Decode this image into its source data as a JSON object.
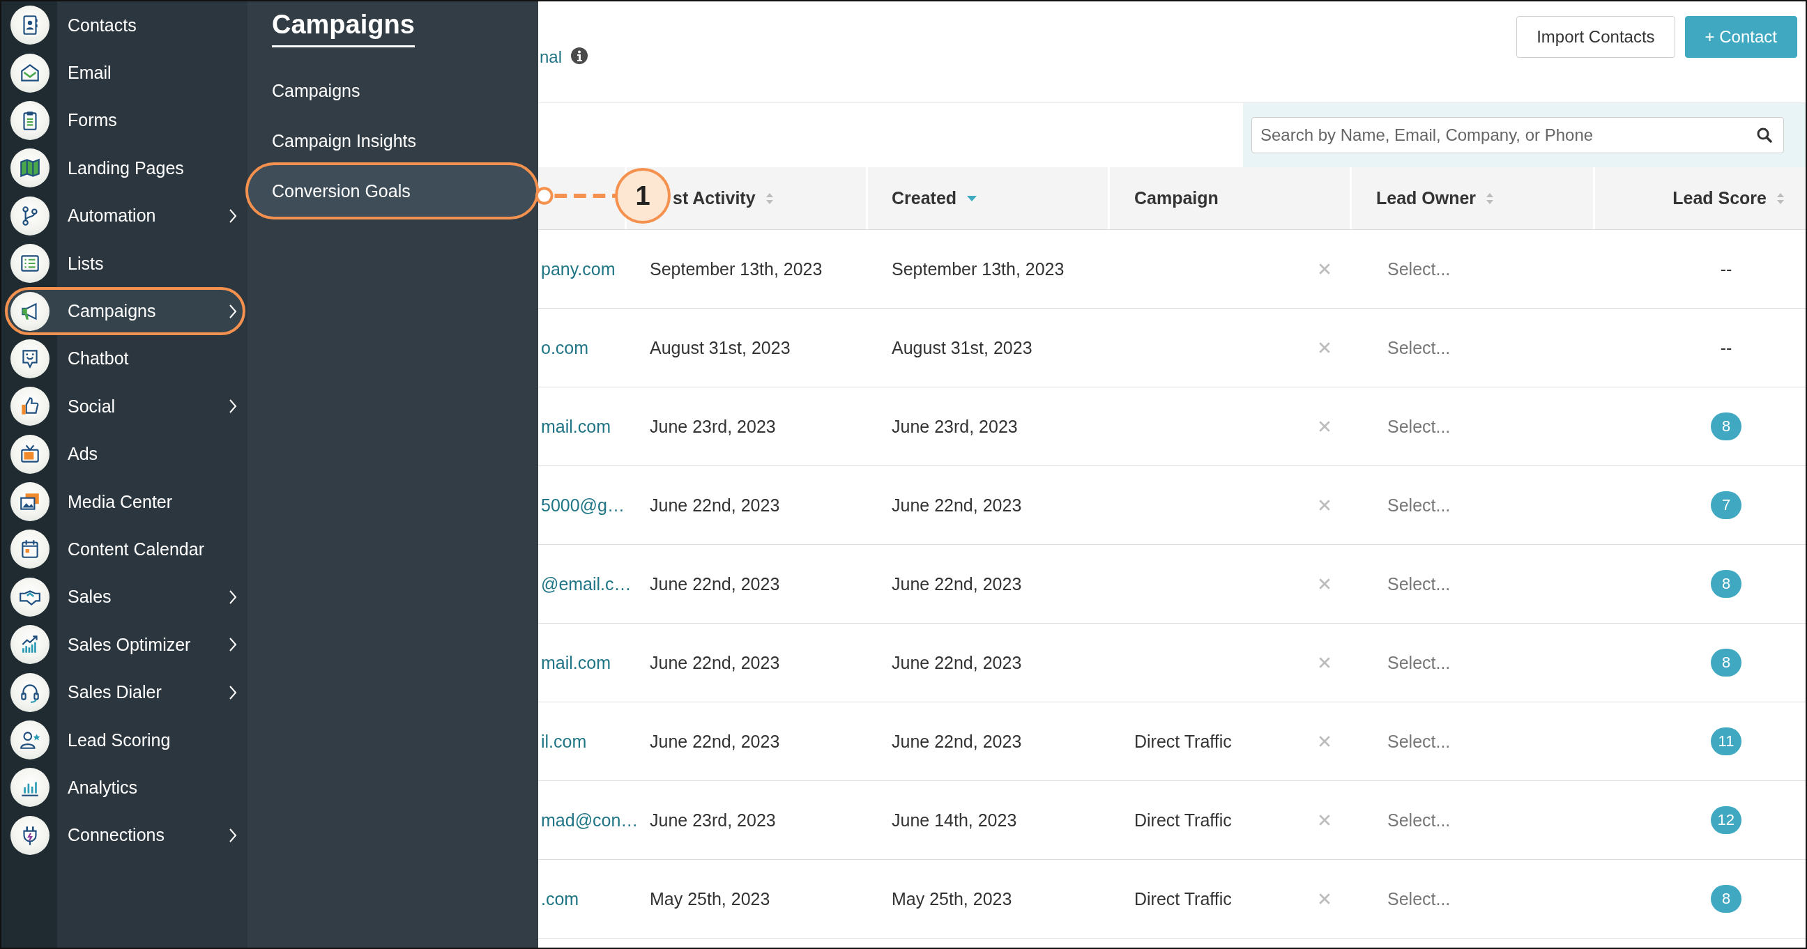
{
  "sidebar": {
    "items": [
      {
        "label": "Contacts",
        "has_submenu": false,
        "selected": false
      },
      {
        "label": "Email",
        "has_submenu": false,
        "selected": false
      },
      {
        "label": "Forms",
        "has_submenu": false,
        "selected": false
      },
      {
        "label": "Landing Pages",
        "has_submenu": false,
        "selected": false
      },
      {
        "label": "Automation",
        "has_submenu": true,
        "selected": false
      },
      {
        "label": "Lists",
        "has_submenu": false,
        "selected": false
      },
      {
        "label": "Campaigns",
        "has_submenu": true,
        "selected": true
      },
      {
        "label": "Chatbot",
        "has_submenu": false,
        "selected": false
      },
      {
        "label": "Social",
        "has_submenu": true,
        "selected": false
      },
      {
        "label": "Ads",
        "has_submenu": false,
        "selected": false
      },
      {
        "label": "Media Center",
        "has_submenu": false,
        "selected": false
      },
      {
        "label": "Content Calendar",
        "has_submenu": false,
        "selected": false
      },
      {
        "label": "Sales",
        "has_submenu": true,
        "selected": false
      },
      {
        "label": "Sales Optimizer",
        "has_submenu": true,
        "selected": false
      },
      {
        "label": "Sales Dialer",
        "has_submenu": true,
        "selected": false
      },
      {
        "label": "Lead Scoring",
        "has_submenu": false,
        "selected": false
      },
      {
        "label": "Analytics",
        "has_submenu": false,
        "selected": false
      },
      {
        "label": "Connections",
        "has_submenu": true,
        "selected": false
      }
    ]
  },
  "submenu": {
    "title": "Campaigns",
    "items": [
      {
        "label": "Campaigns",
        "selected": false
      },
      {
        "label": "Campaign Insights",
        "selected": false
      },
      {
        "label": "Conversion Goals",
        "selected": true
      }
    ]
  },
  "callout": {
    "marker": "1"
  },
  "page": {
    "switch_link": "nal",
    "buttons": [
      {
        "label": "Import Contacts",
        "kind": "secondary"
      },
      {
        "label": "+ Contact",
        "kind": "primary"
      }
    ],
    "search": {
      "placeholder": "Search by Name, Email, Company, or Phone"
    }
  },
  "table": {
    "columns": [
      {
        "label": "st Activity",
        "sortable": true,
        "sorted_descending": false
      },
      {
        "label": "Created",
        "sorted_descending": true
      },
      {
        "label": "Campaign",
        "sortable": false,
        "sorted_descending": false
      },
      {
        "label": "Lead Owner",
        "sortable": true,
        "sorted_descending": false
      },
      {
        "label": "Lead Score",
        "sortable": true,
        "sorted_descending": false
      }
    ],
    "rows": [
      {
        "email": "pany.com",
        "last_activity": "September 13th, 2023",
        "created": "September 13th, 2023",
        "lead_owner": {
          "placeholder": "Select..."
        },
        "lead_score": {
          "kind": "plain",
          "text": "--"
        }
      },
      {
        "email": "o.com",
        "last_activity": "August 31st, 2023",
        "created": "August 31st, 2023",
        "lead_owner": {
          "placeholder": "Select..."
        },
        "lead_score": {
          "kind": "plain",
          "text": "--"
        }
      },
      {
        "email": "mail.com",
        "last_activity": "June 23rd, 2023",
        "created": "June 23rd, 2023",
        "lead_owner": {
          "placeholder": "Select..."
        },
        "lead_score": {
          "kind": "badge",
          "text": "8"
        }
      },
      {
        "email": "5000@g…",
        "last_activity": "June 22nd, 2023",
        "created": "June 22nd, 2023",
        "lead_owner": {
          "placeholder": "Select..."
        },
        "lead_score": {
          "kind": "badge",
          "text": "7"
        }
      },
      {
        "email": "@email.c…",
        "last_activity": "June 22nd, 2023",
        "created": "June 22nd, 2023",
        "lead_owner": {
          "placeholder": "Select..."
        },
        "lead_score": {
          "kind": "badge",
          "text": "8"
        }
      },
      {
        "email": "mail.com",
        "last_activity": "June 22nd, 2023",
        "created": "June 22nd, 2023",
        "lead_owner": {
          "placeholder": "Select..."
        },
        "lead_score": {
          "kind": "badge",
          "text": "8"
        }
      },
      {
        "email": "il.com",
        "last_activity": "June 22nd, 2023",
        "created": "June 22nd, 2023",
        "campaign": "Direct Traffic",
        "lead_owner": {
          "placeholder": "Select..."
        },
        "lead_score": {
          "kind": "badge",
          "text": "11"
        }
      },
      {
        "email": "mad@con…",
        "last_activity": "June 23rd, 2023",
        "created": "June 14th, 2023",
        "campaign": "Direct Traffic",
        "lead_owner": {
          "placeholder": "Select..."
        },
        "lead_score": {
          "kind": "badge",
          "text": "12"
        }
      },
      {
        "email": ".com",
        "last_activity": "May 25th, 2023",
        "created": "May 25th, 2023",
        "campaign": "Direct Traffic",
        "lead_owner": {
          "placeholder": "Select..."
        },
        "lead_score": {
          "kind": "badge",
          "text": "8"
        }
      }
    ]
  }
}
